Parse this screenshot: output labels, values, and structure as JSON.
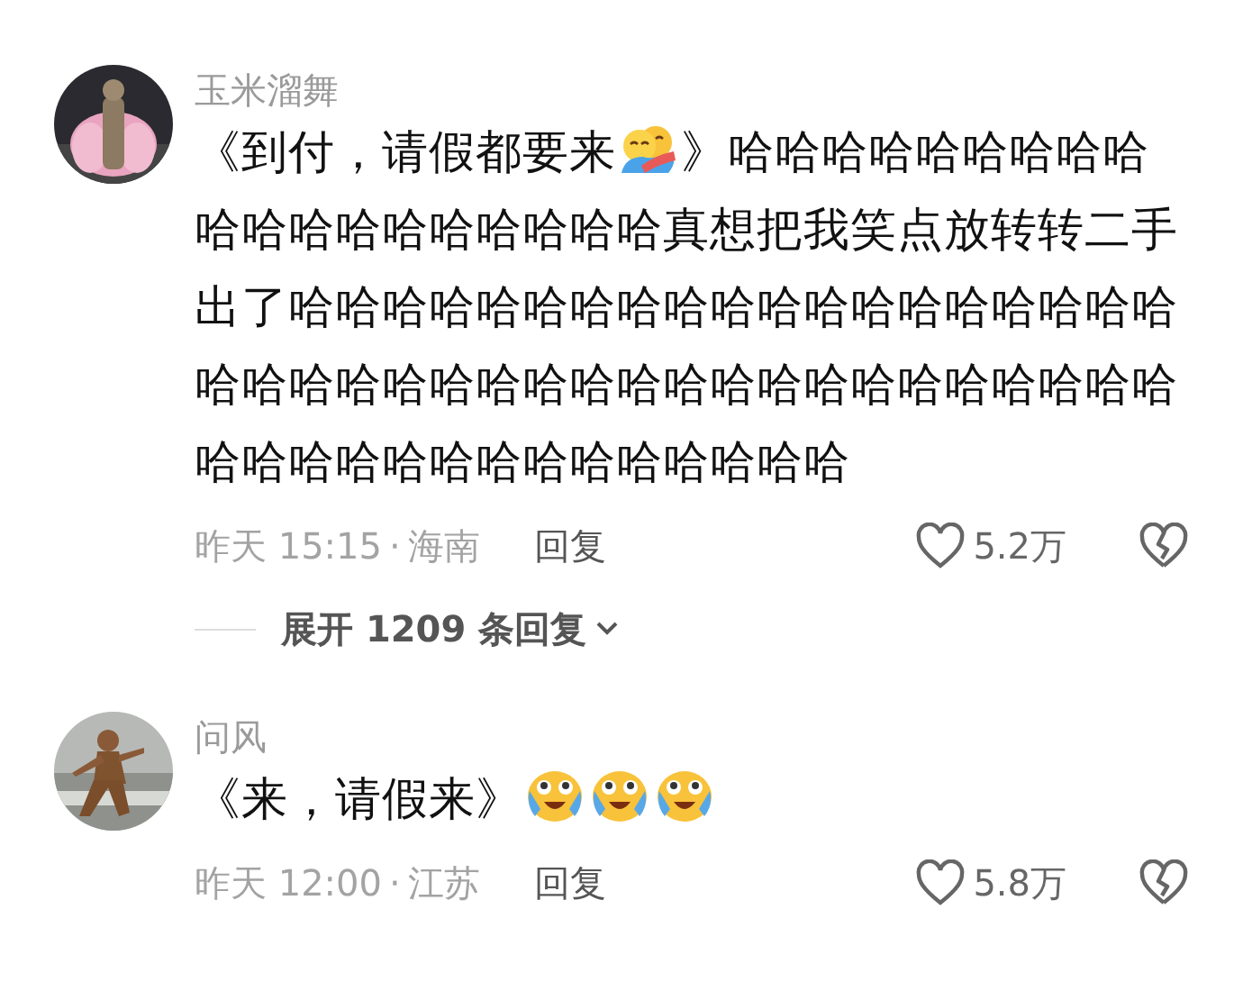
{
  "comments": [
    {
      "author": "玉米溜舞",
      "lines": [
        [
          {
            "kind": "text",
            "text": "《到付，请假都要来"
          },
          {
            "kind": "hug"
          },
          {
            "kind": "text",
            "text": "》哈哈哈哈哈哈哈哈哈"
          }
        ],
        [
          {
            "kind": "text",
            "text": "哈哈哈哈哈哈哈哈哈哈真想把我笑点放转转二手出了哈哈哈哈哈哈哈哈哈哈哈哈哈哈哈哈哈哈哈哈哈哈哈哈哈哈哈哈哈哈哈哈哈哈哈哈哈哈哈哈哈哈哈哈哈哈哈哈哈哈哈哈哈哈"
          }
        ]
      ],
      "time": "昨天 15:15",
      "separator": "·",
      "region": "海南",
      "reply": "回复",
      "likes": "5.2万",
      "expand": "展开 1209 条回复"
    },
    {
      "author": "问风",
      "lines": [
        [
          {
            "kind": "text",
            "text": "《来，请假来》"
          },
          {
            "kind": "tears"
          },
          {
            "kind": "tears"
          },
          {
            "kind": "tears"
          }
        ]
      ],
      "time": "昨天 12:00",
      "separator": "·",
      "region": "江苏",
      "reply": "回复",
      "likes": "5.8万"
    }
  ]
}
